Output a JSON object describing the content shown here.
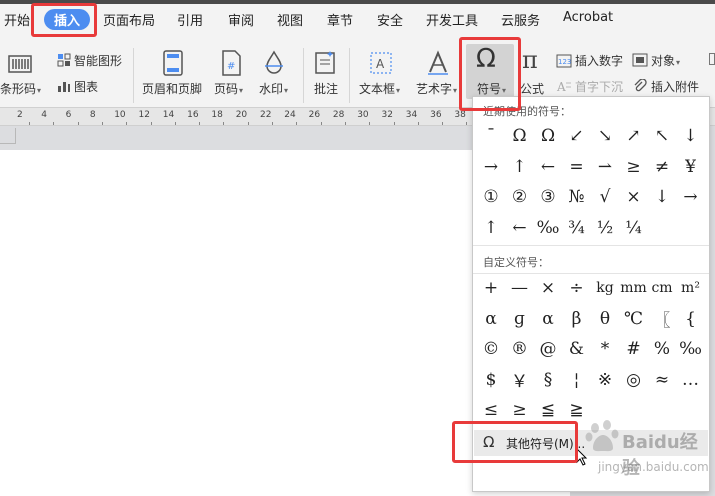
{
  "tabs": [
    "开始",
    "插入",
    "页面布局",
    "引用",
    "审阅",
    "视图",
    "章节",
    "安全",
    "开发工具",
    "云服务",
    "Acrobat"
  ],
  "ribbon": {
    "barcode": "条形码",
    "smart_art": "智能图形",
    "chart": "图表",
    "header_footer": "页眉和页脚",
    "page_number": "页码",
    "watermark": "水印",
    "comment": "批注",
    "textbox": "文本框",
    "wordart": "艺术字",
    "symbol": "符号",
    "formula": "公式",
    "insert_number": "插入数字",
    "object": "对象",
    "drop_cap": "首字下沉",
    "attachment": "插入附件"
  },
  "ruler_marks": [
    "2",
    "4",
    "6",
    "8",
    "10",
    "12",
    "14",
    "16",
    "18",
    "20",
    "22",
    "24",
    "26",
    "28",
    "30",
    "32",
    "34",
    "36",
    "38"
  ],
  "symbol_panel": {
    "recent_title": "近期使用的符号：",
    "recent_symbols": [
      [
        "¯",
        "Ω",
        "Ω",
        "↙",
        "↘",
        "↗",
        "↖",
        "↓"
      ],
      [
        "→",
        "↑",
        "←",
        "=",
        "⇀",
        "≥",
        "≠",
        "¥"
      ],
      [
        "①",
        "②",
        "③",
        "№",
        "√",
        "×",
        "↓",
        "→"
      ],
      [
        "↑",
        "←",
        "‰",
        "¾",
        "½",
        "¼"
      ]
    ],
    "custom_title": "自定义符号：",
    "custom_symbols": [
      [
        "+",
        "—",
        "×",
        "÷",
        "kg",
        "mm",
        "cm",
        "m²"
      ],
      [
        "α",
        "ɡ",
        "α",
        "β",
        "θ",
        "℃",
        "〖",
        "{"
      ],
      [
        "©",
        "®",
        "@",
        "&",
        "*",
        "#",
        "%",
        "‰"
      ],
      [
        "$",
        "￥",
        "§",
        "¦",
        "※",
        "◎",
        "≈",
        "…"
      ],
      [
        "≤",
        "≥",
        "≦",
        "≧"
      ]
    ],
    "other_symbols": "其他符号(M)..."
  },
  "watermark": {
    "brand": "Baidu经验",
    "url": "jingyan.baidu.com"
  },
  "colors": {
    "active_tab": "#4d8df0",
    "highlight": "#e83a3a"
  }
}
